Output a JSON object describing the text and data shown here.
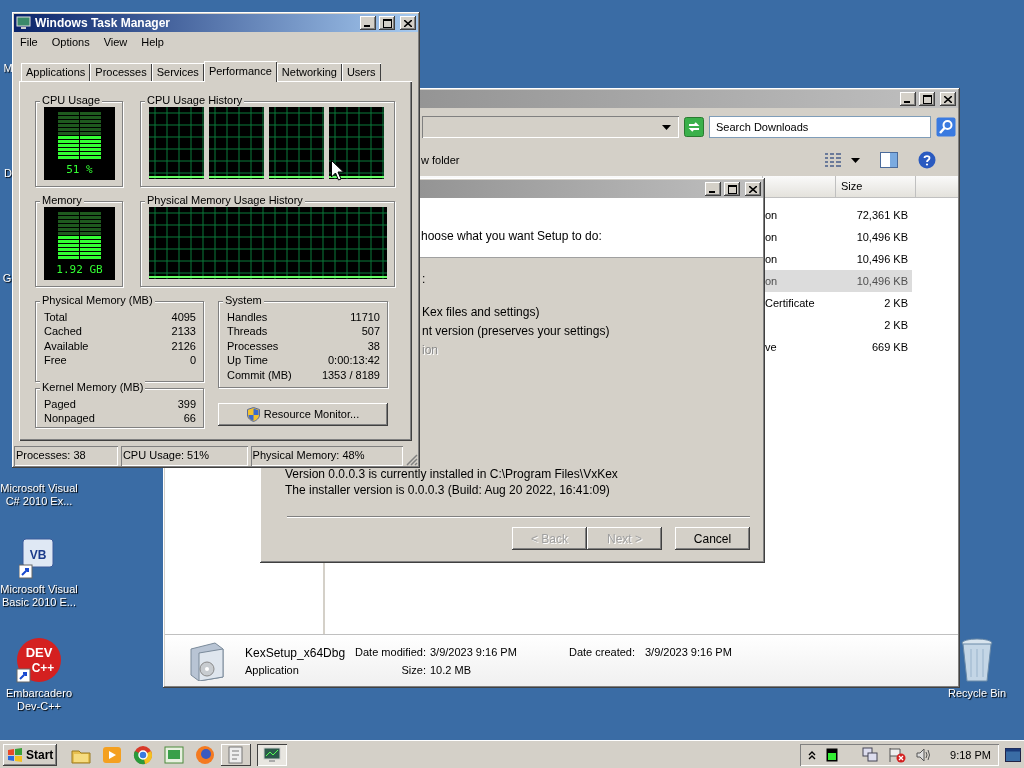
{
  "desktop_icons": [
    {
      "kind": "covered",
      "label": "M"
    },
    {
      "kind": "covered",
      "label": "D"
    },
    {
      "kind": "covered",
      "label": "G"
    },
    {
      "kind": "label_only",
      "label": "Microsoft Visual C# 2010 Ex..."
    },
    {
      "kind": "vb",
      "label": "Microsoft Visual Basic 2010 E...",
      "badge": "VB"
    },
    {
      "kind": "devcpp",
      "label": "Embarcadero Dev-C++",
      "badge": "DEV",
      "badge_2": "C++"
    },
    {
      "kind": "recycle",
      "label": "Recycle Bin"
    }
  ],
  "explorer": {
    "search_placeholder": "Search Downloads",
    "toolbar_text": "w folder",
    "size_column": "Size",
    "rows": [
      {
        "type": "on",
        "size": "72,361 KB",
        "selected": false
      },
      {
        "type": "on",
        "size": "10,496 KB",
        "selected": false
      },
      {
        "type": "on",
        "size": "10,496 KB",
        "selected": false
      },
      {
        "type": "on",
        "size": "10,496 KB",
        "selected": true
      },
      {
        "type": "Certificate",
        "size": "2 KB",
        "selected": false
      },
      {
        "size": "2 KB",
        "selected": false
      },
      {
        "type": "ve",
        "size": "669 KB",
        "selected": false
      }
    ],
    "details": {
      "name": "KexSetup_x64Dbg",
      "type": "Application",
      "fields": [
        {
          "label": "Date modified:",
          "value": "3/9/2023 9:16 PM"
        },
        {
          "label": "Date created:",
          "value": "3/9/2023 9:16 PM"
        },
        {
          "label": "Size:",
          "value": "10.2 MB"
        }
      ]
    }
  },
  "setup": {
    "header_text": "hoose what you want Setup to do:",
    "section_label": ":",
    "options": [
      {
        "label": "Kex files and settings)",
        "disabled": false
      },
      {
        "label": "nt version (preserves your settings)",
        "disabled": false
      },
      {
        "label": "ion",
        "disabled": true
      }
    ],
    "info": [
      "Version 0.0.0.3 is currently installed in C:\\Program Files\\VxKex",
      "The installer version is 0.0.0.3 (Build: Aug 20 2022, 16:41:09)"
    ],
    "buttons": [
      {
        "label": "< Back",
        "disabled": true
      },
      {
        "label": "Next >",
        "disabled": true
      },
      {
        "label": "Cancel",
        "disabled": false
      }
    ]
  },
  "task_manager": {
    "title": "Windows Task Manager",
    "menu": [
      "File",
      "Options",
      "View",
      "Help"
    ],
    "tabs": [
      {
        "label": "Applications",
        "selected": false
      },
      {
        "label": "Processes",
        "selected": false
      },
      {
        "label": "Services",
        "selected": false
      },
      {
        "label": "Performance",
        "selected": true
      },
      {
        "label": "Networking",
        "selected": false
      },
      {
        "label": "Users",
        "selected": false
      }
    ],
    "cpu_usage": {
      "title": "CPU Usage",
      "reading": "51 %",
      "level": 0.51
    },
    "cpu_history": {
      "title": "CPU Usage History"
    },
    "memory": {
      "title": "Memory",
      "reading": "1.92 GB",
      "level": 0.48
    },
    "memory_history": {
      "title": "Physical Memory Usage History"
    },
    "physical_memory": {
      "title": "Physical Memory (MB)",
      "rows": [
        {
          "label": "Total",
          "value": "4095"
        },
        {
          "label": "Cached",
          "value": "2133"
        },
        {
          "label": "Available",
          "value": "2126"
        },
        {
          "label": "Free",
          "value": "0"
        }
      ]
    },
    "kernel_memory": {
      "title": "Kernel Memory (MB)",
      "rows": [
        {
          "label": "Paged",
          "value": "399"
        },
        {
          "label": "Nonpaged",
          "value": "66"
        }
      ]
    },
    "system": {
      "title": "System",
      "rows": [
        {
          "label": "Handles",
          "value": "11710"
        },
        {
          "label": "Threads",
          "value": "507"
        },
        {
          "label": "Processes",
          "value": "38"
        },
        {
          "label": "Up Time",
          "value": "0:00:13:42"
        },
        {
          "label": "Commit (MB)",
          "value": "1353 / 8189"
        }
      ]
    },
    "resource_monitor_button": "Resource Monitor...",
    "status_bar": [
      "Processes: 38",
      "CPU Usage: 51%",
      "Physical Memory: 48%"
    ]
  },
  "taskbar": {
    "start": "Start",
    "task_buttons": [
      {
        "selected": false
      },
      {
        "selected": true
      }
    ],
    "clock": "9:18 PM"
  }
}
